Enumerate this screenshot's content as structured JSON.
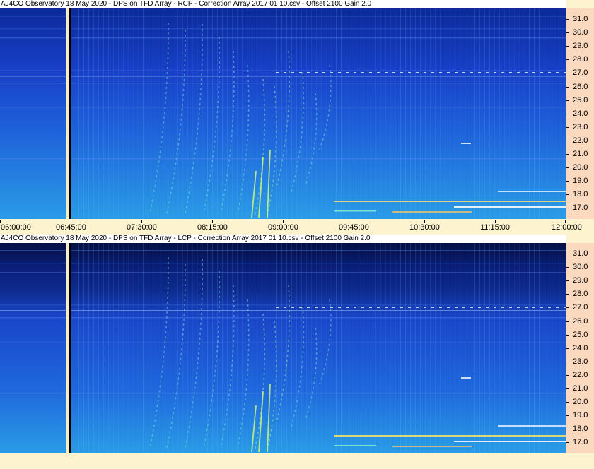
{
  "colors": {
    "background": "#fdf3cf",
    "freq_axis_bg": "#fbd9bf",
    "spectrogram_deep": "#061a66",
    "spectrogram_mid": "#1d4fd6",
    "spectrogram_low": "#2a8ee8",
    "signal": "#7ff0d8"
  },
  "panels": [
    {
      "id": "rcp",
      "title": "AJ4CO Observatory 18 May 2020  -  DPS on TFD Array  -  RCP  -  Correction Array 2017 01 10.csv  -  Offset 2100  Gain 2.0"
    },
    {
      "id": "lcp",
      "title": "AJ4CO Observatory 18 May 2020  -  DPS on TFD Array  -  LCP  -  Correction Array 2017 01 10.csv  -  Offset 2100  Gain 2.0"
    }
  ],
  "freq_labels": [
    "31.0",
    "30.0",
    "29.0",
    "28.0",
    "27.0",
    "26.0",
    "25.0",
    "24.0",
    "23.0",
    "22.0",
    "21.0",
    "20.0",
    "19.0",
    "18.0",
    "17.0"
  ],
  "time_labels": [
    "06:00:00",
    "06:45:00",
    "07:30:00",
    "08:15:00",
    "09:00:00",
    "09:45:00",
    "10:30:00",
    "11:15:00",
    "12:00:00"
  ]
}
